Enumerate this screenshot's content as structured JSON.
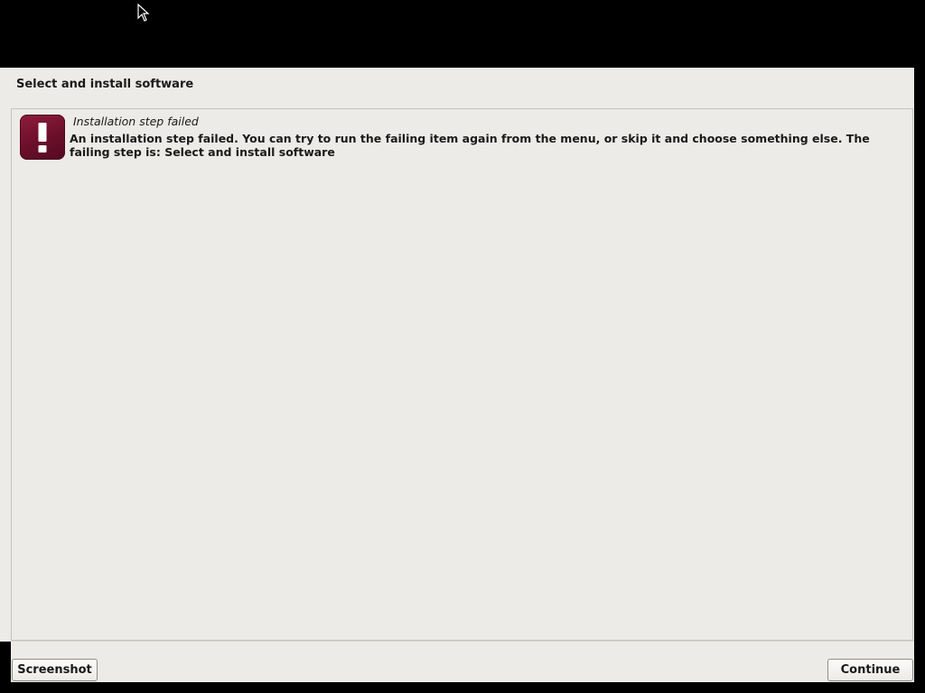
{
  "header": {
    "title": "Select and install software"
  },
  "message": {
    "icon": "error-exclamation-icon",
    "subtitle": "Installation step failed",
    "body": "An installation step failed. You can try to run the failing item again from the menu, or skip it and choose something else. The failing step is: Select and install software"
  },
  "footer": {
    "screenshot_label": "Screenshot",
    "continue_label": "Continue"
  },
  "colors": {
    "error_icon": "#6b0f2b",
    "window_background": "#edebe7",
    "screen_background": "#000000"
  }
}
